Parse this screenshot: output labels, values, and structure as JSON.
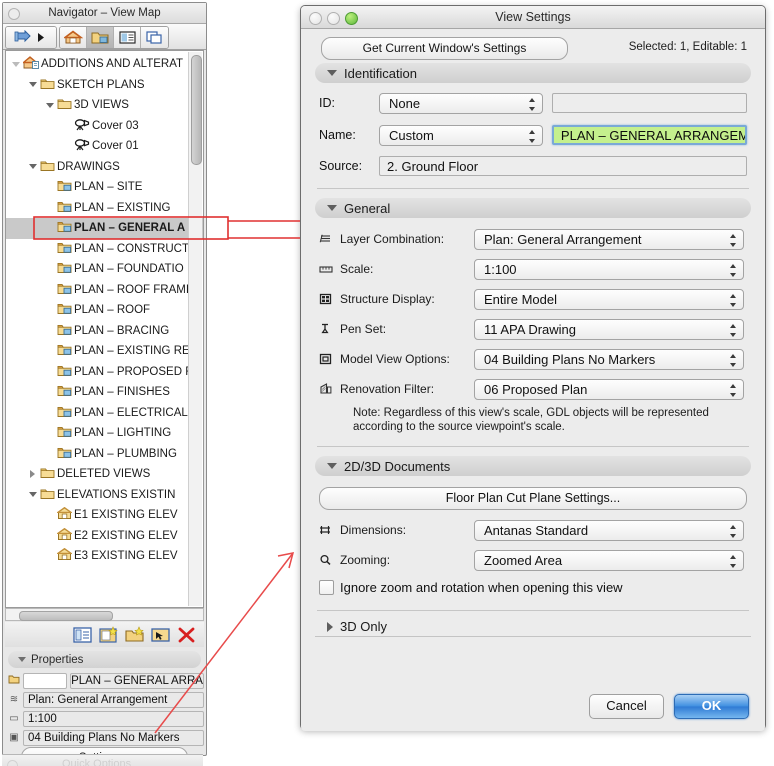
{
  "navigator": {
    "title": "Navigator – View Map",
    "toolbar": {
      "nav_arrow_icon": "navigate-arrow-icon",
      "buttons": [
        {
          "name": "project-map-tab",
          "icon": "house-orange-icon",
          "active": false
        },
        {
          "name": "view-map-tab",
          "icon": "view-map-folder-icon",
          "active": true
        },
        {
          "name": "layout-book-tab",
          "icon": "layout-book-icon",
          "active": false
        },
        {
          "name": "publisher-sets-tab",
          "icon": "publisher-sets-icon",
          "active": false
        }
      ]
    },
    "tree": [
      {
        "label": "ADDITIONS AND ALTERAT",
        "depth": 0,
        "twisty": "open",
        "icon": "project-icon",
        "selected": false
      },
      {
        "label": "SKETCH PLANS",
        "depth": 1,
        "twisty": "open",
        "icon": "folder-icon",
        "selected": false
      },
      {
        "label": "3D VIEWS",
        "depth": 2,
        "twisty": "open",
        "icon": "folder-icon",
        "selected": false
      },
      {
        "label": "Cover 03",
        "depth": 3,
        "twisty": "none",
        "icon": "camera-icon",
        "selected": false
      },
      {
        "label": "Cover 01",
        "depth": 3,
        "twisty": "none",
        "icon": "camera-icon",
        "selected": false
      },
      {
        "label": "DRAWINGS",
        "depth": 1,
        "twisty": "open",
        "icon": "folder-icon",
        "selected": false
      },
      {
        "label": "PLAN – SITE",
        "depth": 2,
        "twisty": "none",
        "icon": "plan-icon",
        "selected": false
      },
      {
        "label": "PLAN – EXISTING",
        "depth": 2,
        "twisty": "none",
        "icon": "plan-icon",
        "selected": false
      },
      {
        "label": "PLAN – GENERAL A",
        "depth": 2,
        "twisty": "none",
        "icon": "plan-icon",
        "selected": true
      },
      {
        "label": "PLAN – CONSTRUCT",
        "depth": 2,
        "twisty": "none",
        "icon": "plan-icon",
        "selected": false
      },
      {
        "label": "PLAN – FOUNDATIO",
        "depth": 2,
        "twisty": "none",
        "icon": "plan-icon",
        "selected": false
      },
      {
        "label": "PLAN – ROOF FRAMI",
        "depth": 2,
        "twisty": "none",
        "icon": "plan-icon",
        "selected": false
      },
      {
        "label": "PLAN – ROOF",
        "depth": 2,
        "twisty": "none",
        "icon": "plan-icon",
        "selected": false
      },
      {
        "label": "PLAN – BRACING",
        "depth": 2,
        "twisty": "none",
        "icon": "plan-icon",
        "selected": false
      },
      {
        "label": "PLAN – EXISTING RE",
        "depth": 2,
        "twisty": "none",
        "icon": "plan-icon",
        "selected": false
      },
      {
        "label": "PLAN – PROPOSED R",
        "depth": 2,
        "twisty": "none",
        "icon": "plan-icon",
        "selected": false
      },
      {
        "label": "PLAN – FINISHES",
        "depth": 2,
        "twisty": "none",
        "icon": "plan-icon",
        "selected": false
      },
      {
        "label": "PLAN – ELECTRICAL",
        "depth": 2,
        "twisty": "none",
        "icon": "plan-icon",
        "selected": false
      },
      {
        "label": "PLAN – LIGHTING",
        "depth": 2,
        "twisty": "none",
        "icon": "plan-icon",
        "selected": false
      },
      {
        "label": "PLAN – PLUMBING",
        "depth": 2,
        "twisty": "none",
        "icon": "plan-icon",
        "selected": false
      },
      {
        "label": "DELETED VIEWS",
        "depth": 1,
        "twisty": "closed",
        "icon": "folder-icon",
        "selected": false
      },
      {
        "label": "ELEVATIONS EXISTIN",
        "depth": 1,
        "twisty": "open",
        "icon": "folder-icon",
        "selected": false
      },
      {
        "label": "E1 EXISTING ELEV",
        "depth": 2,
        "twisty": "none",
        "icon": "elevation-icon",
        "selected": false
      },
      {
        "label": "E2 EXISTING  ELEV",
        "depth": 2,
        "twisty": "none",
        "icon": "elevation-icon",
        "selected": false
      },
      {
        "label": "E3 EXISTING ELEV",
        "depth": 2,
        "twisty": "none",
        "icon": "elevation-icon",
        "selected": false
      }
    ],
    "bottom_buttons": [
      {
        "name": "view-settings-button",
        "icon": "settings-panel-icon"
      },
      {
        "name": "save-current-view-button",
        "icon": "new-view-icon"
      },
      {
        "name": "new-folder-button",
        "icon": "new-folder-icon"
      },
      {
        "name": "open-view-button",
        "icon": "open-view-icon"
      },
      {
        "name": "delete-button",
        "icon": "delete-x-icon"
      }
    ],
    "properties": {
      "header": "Properties",
      "id_value": "",
      "name_value": "PLAN – GENERAL ARRA",
      "layer_combination": "Plan: General Arrangement",
      "scale": "1:100",
      "model_view_options": "04 Building Plans No Markers",
      "settings_button": "Settings..."
    },
    "quick_options_label": "Quick Options"
  },
  "dialog": {
    "title": "View Settings",
    "get_current_button": "Get Current Window's Settings",
    "selected_info": "Selected: 1, Editable: 1",
    "identification": {
      "header": "Identification",
      "id_label": "ID:",
      "id_popup": "None",
      "id_field": "",
      "name_label": "Name:",
      "name_popup": "Custom",
      "name_field": "PLAN – GENERAL ARRANGEM",
      "source_label": "Source:",
      "source_field": "2. Ground Floor"
    },
    "general": {
      "header": "General",
      "rows": [
        {
          "icon": "layers-icon",
          "label": "Layer Combination:",
          "value": "Plan: General Arrangement"
        },
        {
          "icon": "ruler-icon",
          "label": "Scale:",
          "value": "1:100"
        },
        {
          "icon": "structure-icon",
          "label": "Structure Display:",
          "value": "Entire Model"
        },
        {
          "icon": "pen-icon",
          "label": "Pen Set:",
          "value": "11 APA Drawing"
        },
        {
          "icon": "model-view-icon",
          "label": "Model View Options:",
          "value": "04 Building Plans No Markers"
        },
        {
          "icon": "renovation-icon",
          "label": "Renovation Filter:",
          "value": "06 Proposed Plan"
        }
      ],
      "note": "Note: Regardless of this view's scale, GDL objects will be represented according to the source viewpoint's scale."
    },
    "documents": {
      "header": "2D/3D Documents",
      "cut_plane_button": "Floor Plan Cut Plane Settings...",
      "rows": [
        {
          "icon": "dimensions-icon",
          "label": "Dimensions:",
          "value": "Antanas Standard"
        },
        {
          "icon": "magnifier-icon",
          "label": "Zooming:",
          "value": "Zoomed Area"
        }
      ],
      "checkbox_label": "Ignore zoom and rotation when opening this view",
      "checkbox_checked": false
    },
    "three_d_only": {
      "header": "3D Only"
    },
    "footer": {
      "cancel": "Cancel",
      "ok": "OK"
    }
  },
  "annotations": {
    "highlight_color": "#e03030",
    "arrow_color": "#e84b4b"
  }
}
